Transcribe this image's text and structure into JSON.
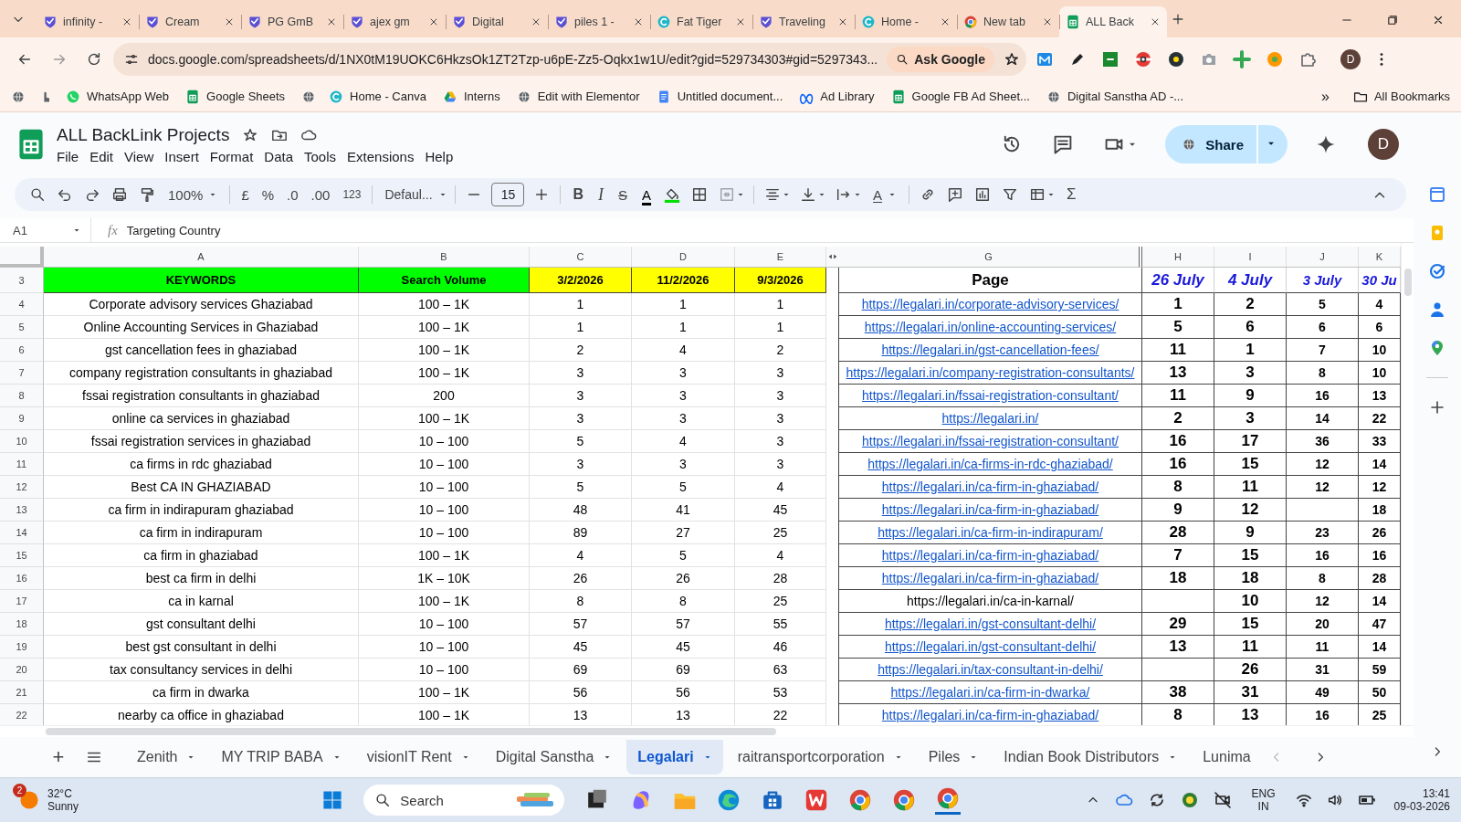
{
  "browser_tabs": [
    {
      "title": "infinity -",
      "selected": false
    },
    {
      "title": "Cream",
      "selected": false
    },
    {
      "title": "PG GmB",
      "selected": false
    },
    {
      "title": "ajex gm",
      "selected": false
    },
    {
      "title": "Digital",
      "selected": false
    },
    {
      "title": "piles 1 -",
      "selected": false
    },
    {
      "title": "Fat Tiger",
      "selected": false
    },
    {
      "title": "Traveling",
      "selected": false
    },
    {
      "title": "Home -",
      "selected": false
    },
    {
      "title": "New tab",
      "selected": false
    },
    {
      "title": "ALL Back",
      "selected": true
    }
  ],
  "address_bar": {
    "url": "docs.google.com/spreadsheets/d/1NX0tM19UOKC6HkzsOk1ZT2Tzp-u6pE-Zz5-Oqkx1w1U/edit?gid=529734303#gid=5297343...",
    "ask_button": "Ask Google",
    "profile": "D"
  },
  "bookmarks": [
    "WhatsApp Web",
    "Google Sheets",
    "Home - Canva",
    "Interns",
    "Edit with Elementor",
    "Untitled document...",
    "Ad Library",
    "Google FB Ad Sheet...",
    "Digital Sanstha AD -..."
  ],
  "more_bookmarks": "»",
  "all_bookmarks": "All Bookmarks",
  "document": {
    "title": "ALL BackLink Projects",
    "menu": [
      "File",
      "Edit",
      "View",
      "Insert",
      "Format",
      "Data",
      "Tools",
      "Extensions",
      "Help"
    ],
    "share": "Share",
    "avatar": "D"
  },
  "toolbar": [
    "100%",
    "£",
    "%",
    ".0",
    ".00",
    "123",
    "Defaul...",
    "15",
    "B",
    "I",
    "S",
    "A",
    "A",
    "Σ"
  ],
  "formula_bar": {
    "cell": "A1",
    "fx": "fx",
    "value": "Targeting Country"
  },
  "grid": {
    "columns": [
      "A",
      "B",
      "C",
      "D",
      "E",
      "G",
      "H",
      "I",
      "J",
      "K"
    ],
    "header": {
      "num": "3",
      "cells": [
        {
          "text": "KEYWORDS",
          "color": "#00ff00"
        },
        {
          "text": "Search Volume",
          "color": "#00ff00"
        },
        {
          "text": "3/2/2026",
          "color": "#ffff00"
        },
        {
          "text": "11/2/2026",
          "color": "#ffff00"
        },
        {
          "text": "9/3/2026",
          "color": "#ffff00"
        }
      ],
      "page": "Page",
      "dates": [
        "26 July",
        "4 July",
        "3 July",
        "30 Ju"
      ]
    },
    "rows": [
      {
        "num": "4",
        "cells": [
          "Corporate advisory services Ghaziabad",
          "100 – 1K",
          "1",
          "1",
          "1"
        ],
        "page": {
          "text": "https://legalari.in/corporate-advisory-services/",
          "link": true
        },
        "ranks": {
          "h": "1",
          "i": "2",
          "j": "5",
          "k": "4"
        }
      },
      {
        "num": "5",
        "cells": [
          "Online Accounting Services in Ghaziabad",
          "100 – 1K",
          "1",
          "1",
          "1"
        ],
        "page": {
          "text": "https://legalari.in/online-accounting-services/",
          "link": true
        },
        "ranks": {
          "h": "5",
          "i": "6",
          "j": "6",
          "k": "6"
        }
      },
      {
        "num": "6",
        "cells": [
          "gst cancellation fees in ghaziabad",
          "100 – 1K",
          "2",
          "4",
          "2"
        ],
        "page": {
          "text": "https://legalari.in/gst-cancellation-fees/",
          "link": true
        },
        "ranks": {
          "h": "11",
          "i": "1",
          "j": "7",
          "k": "10"
        }
      },
      {
        "num": "7",
        "cells": [
          "company registration consultants in ghaziabad",
          "100 – 1K",
          "3",
          "3",
          "3"
        ],
        "page": {
          "text": "https://legalari.in/company-registration-consultants/",
          "link": true
        },
        "ranks": {
          "h": "13",
          "i": "3",
          "j": "8",
          "k": "10"
        }
      },
      {
        "num": "8",
        "cells": [
          "fssai registration consultants in ghaziabad",
          "200",
          "3",
          "3",
          "3"
        ],
        "page": {
          "text": "https://legalari.in/fssai-registration-consultant/",
          "link": true
        },
        "ranks": {
          "h": "11",
          "i": "9",
          "j": "16",
          "k": "13"
        }
      },
      {
        "num": "9",
        "cells": [
          "online ca services in ghaziabad",
          "100 – 1K",
          "3",
          "3",
          "3"
        ],
        "page": {
          "text": "https://legalari.in/",
          "link": true
        },
        "ranks": {
          "h": "2",
          "i": "3",
          "j": "14",
          "k": "22"
        }
      },
      {
        "num": "10",
        "cells": [
          "fssai registration services in ghaziabad",
          "10 – 100",
          "5",
          "4",
          "3"
        ],
        "page": {
          "text": "https://legalari.in/fssai-registration-consultant/",
          "link": true
        },
        "ranks": {
          "h": "16",
          "i": "17",
          "j": "36",
          "k": "33"
        }
      },
      {
        "num": "11",
        "cells": [
          "ca firms in rdc ghaziabad",
          "10 – 100",
          "3",
          "3",
          "3"
        ],
        "page": {
          "text": "https://legalari.in/ca-firms-in-rdc-ghaziabad/",
          "link": true
        },
        "ranks": {
          "h": "16",
          "i": "15",
          "j": "12",
          "k": "14"
        }
      },
      {
        "num": "12",
        "cells": [
          "Best CA IN GHAZIABAD",
          "10 – 100",
          "5",
          "5",
          "4"
        ],
        "page": {
          "text": "https://legalari.in/ca-firm-in-ghaziabad/",
          "link": true
        },
        "ranks": {
          "h": "8",
          "i": "11",
          "j": "12",
          "k": "12"
        }
      },
      {
        "num": "13",
        "cells": [
          "ca firm in indirapuram ghaziabad",
          "10 – 100",
          "48",
          "41",
          "45"
        ],
        "page": {
          "text": "https://legalari.in/ca-firm-in-ghaziabad/",
          "link": true
        },
        "ranks": {
          "h": "9",
          "i": "12",
          "k": "18"
        }
      },
      {
        "num": "14",
        "cells": [
          "ca firm in indirapuram",
          "10 – 100",
          "89",
          "27",
          "25"
        ],
        "page": {
          "text": "https://legalari.in/ca-firm-in-indirapuram/",
          "link": true
        },
        "ranks": {
          "h": "28",
          "i": "9",
          "j": "23",
          "k": "26"
        }
      },
      {
        "num": "15",
        "cells": [
          "ca firm in ghaziabad",
          "100 – 1K",
          "4",
          "5",
          "4"
        ],
        "page": {
          "text": "https://legalari.in/ca-firm-in-ghaziabad/",
          "link": true
        },
        "ranks": {
          "h": "7",
          "i": "15",
          "j": "16",
          "k": "16"
        }
      },
      {
        "num": "16",
        "cells": [
          "best ca firm in delhi",
          "1K – 10K",
          "26",
          "26",
          "28"
        ],
        "page": {
          "text": "https://legalari.in/ca-firm-in-ghaziabad/",
          "link": true
        },
        "ranks": {
          "h": "18",
          "i": "18",
          "j": "8",
          "k": "28"
        }
      },
      {
        "num": "17",
        "cells": [
          "ca in karnal",
          "100 – 1K",
          "8",
          "8",
          "25"
        ],
        "page": {
          "text": "https://legalari.in/ca-in-karnal/",
          "link": false
        },
        "ranks": {
          "i": "10",
          "j": "12",
          "k": "14"
        }
      },
      {
        "num": "18",
        "cells": [
          "gst consultant delhi",
          "10 – 100",
          "57",
          "57",
          "55"
        ],
        "page": {
          "text": "https://legalari.in/gst-consultant-delhi/",
          "link": true
        },
        "ranks": {
          "h": "29",
          "i": "15",
          "j": "20",
          "k": "47"
        }
      },
      {
        "num": "19",
        "cells": [
          "best gst consultant in delhi",
          "10 – 100",
          "45",
          "45",
          "46"
        ],
        "page": {
          "text": "https://legalari.in/gst-consultant-delhi/",
          "link": true
        },
        "ranks": {
          "h": "13",
          "i": "11",
          "j": "11",
          "k": "14"
        }
      },
      {
        "num": "20",
        "cells": [
          "tax consultancy services in delhi",
          "10 – 100",
          "69",
          "69",
          "63"
        ],
        "page": {
          "text": "https://legalari.in/tax-consultant-in-delhi/",
          "link": true
        },
        "ranks": {
          "i": "26",
          "j": "31",
          "k": "59"
        }
      },
      {
        "num": "21",
        "cells": [
          "ca firm in dwarka",
          "100 – 1K",
          "56",
          "56",
          "53"
        ],
        "page": {
          "text": "https://legalari.in/ca-firm-in-dwarka/",
          "link": true
        },
        "ranks": {
          "h": "38",
          "i": "31",
          "j": "49",
          "k": "50"
        }
      },
      {
        "num": "22",
        "cells": [
          "nearby ca office in ghaziabad",
          "100 – 1K",
          "13",
          "13",
          "22"
        ],
        "page": {
          "text": "https://legalari.in/ca-firm-in-ghaziabad/",
          "link": true
        },
        "ranks": {
          "h": "8",
          "i": "13",
          "j": "16",
          "k": "25"
        }
      }
    ]
  },
  "sheet_tabs": [
    {
      "label": "Zenith",
      "selected": false
    },
    {
      "label": "MY TRIP BABA",
      "selected": false
    },
    {
      "label": "visionIT Rent",
      "selected": false
    },
    {
      "label": "Digital Sanstha",
      "selected": false
    },
    {
      "label": "Legalari",
      "selected": true
    },
    {
      "label": "raitransportcorporation",
      "selected": false
    },
    {
      "label": "Piles",
      "selected": false
    },
    {
      "label": "Indian Book Distributors",
      "selected": false
    },
    {
      "label": "Lunima",
      "selected": false
    }
  ],
  "add_sheet": "+",
  "taskbar": {
    "badge": "2",
    "temperature": "32°C",
    "weather": "Sunny",
    "search": "Search",
    "language": "ENG",
    "region": "IN",
    "time": "13:41",
    "date": "09-03-2026"
  }
}
